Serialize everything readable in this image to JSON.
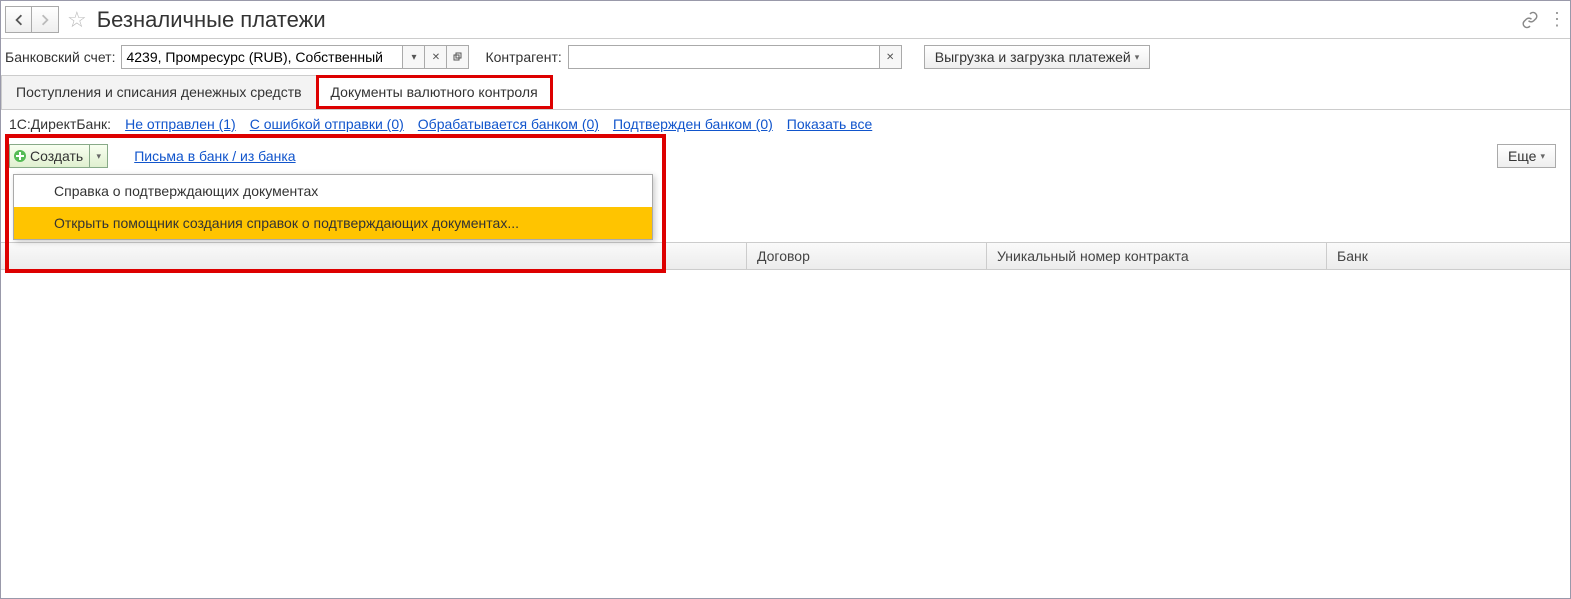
{
  "header": {
    "title": "Безналичные платежи"
  },
  "filter": {
    "bank_account_label": "Банковский счет:",
    "bank_account_value": "4239, Промресурс (RUB), Собственный",
    "counterparty_label": "Контрагент:",
    "counterparty_value": "",
    "upload_button": "Выгрузка и загрузка платежей"
  },
  "tabs": {
    "tab1": "Поступления и списания денежных средств",
    "tab2": "Документы валютного контроля"
  },
  "status": {
    "prefix": "1С:ДиректБанк:",
    "not_sent": "Не отправлен (1)",
    "send_error": "С ошибкой отправки (0)",
    "processing": "Обрабатывается банком (0)",
    "confirmed": "Подтвержден банком (0)",
    "show_all": "Показать все"
  },
  "toolbar": {
    "create": "Создать",
    "letters_link": "Письма в банк / из банка",
    "more": "Еще"
  },
  "dropdown": {
    "item1": "Справка о подтверждающих документах",
    "item2": "Открыть помощник создания справок о подтверждающих документах..."
  },
  "table": {
    "col_contract": "Договор",
    "col_unique": "Уникальный номер контракта",
    "col_bank": "Банк"
  }
}
